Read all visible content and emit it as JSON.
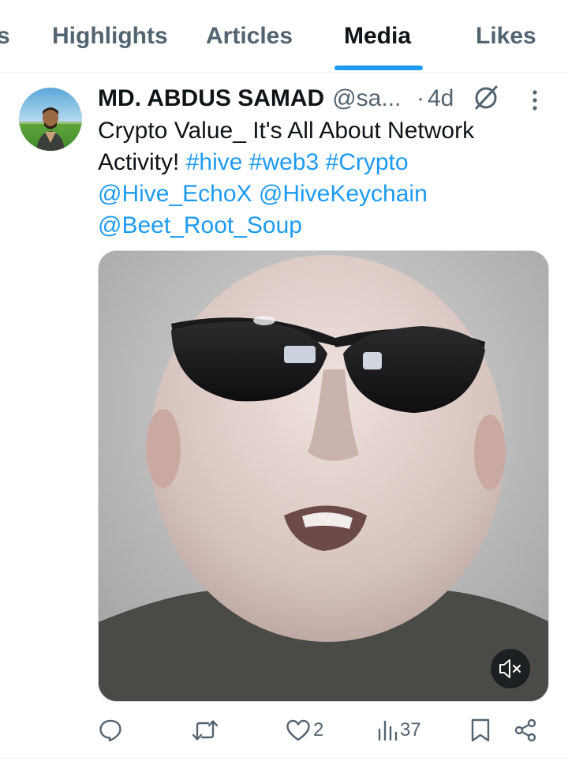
{
  "tabs": [
    {
      "label": "s"
    },
    {
      "label": "Highlights"
    },
    {
      "label": "Articles"
    },
    {
      "label": "Media",
      "active": true
    },
    {
      "label": "Likes"
    }
  ],
  "post": {
    "author": {
      "display_name": "MD. ABDUS SAMAD",
      "handle": "@sa...",
      "separator": "·",
      "time": "4d"
    },
    "text": {
      "plain": "Crypto Value_ It's All About Network Activity!",
      "hashtags": [
        "#hive",
        "#web3",
        "#Crypto"
      ],
      "mentions": [
        "@Hive_EchoX",
        "@HiveKeychain",
        "@Beet_Root_Soup"
      ]
    },
    "media": {
      "type": "video",
      "muted": true
    },
    "actions": {
      "reply_count": "",
      "repost_count": "",
      "like_count": "2",
      "views_count": "37"
    }
  },
  "colors": {
    "accent": "#1d9bf0",
    "text_primary": "#0f1419",
    "text_secondary": "#536471",
    "divider": "#eff3f4"
  },
  "icons": [
    "grok-icon",
    "more-vertical-icon",
    "reply-icon",
    "repost-icon",
    "like-icon",
    "views-icon",
    "bookmark-icon",
    "share-icon",
    "mute-icon"
  ]
}
